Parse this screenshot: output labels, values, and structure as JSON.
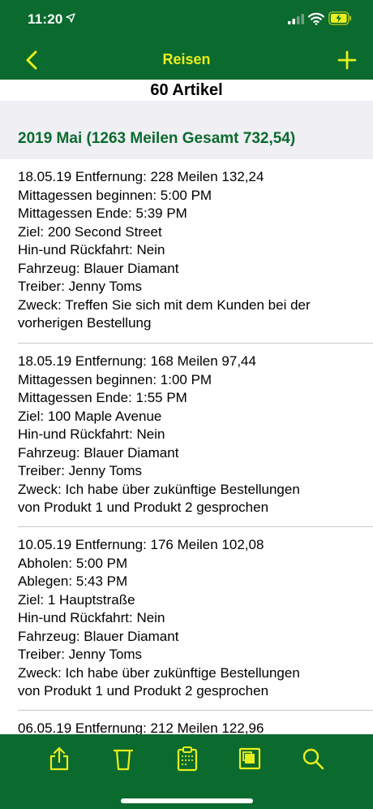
{
  "status_bar": {
    "time": "11:20",
    "location_icon": "location-arrow-icon",
    "signal_icon": "cellular-signal-icon",
    "wifi_icon": "wifi-icon",
    "battery_icon": "battery-charging-icon"
  },
  "nav": {
    "title": "Reisen",
    "back_icon": "chevron-left-icon",
    "add_icon": "plus-icon"
  },
  "colors": {
    "brand_green": "#0b6a2e",
    "accent_yellow": "#e8ef1c",
    "section_bg": "#efeff4"
  },
  "count_label": "60 Artikel",
  "section": {
    "title": "2019 Mai (1263 Meilen Gesamt 732,54)"
  },
  "entries": [
    {
      "lines": [
        "18.05.19 Entfernung: 228 Meilen 132,24",
        "Mittagessen beginnen: 5:00 PM",
        "Mittagessen Ende: 5:39 PM",
        "Ziel: 200 Second Street",
        "Hin-und Rückfahrt: Nein",
        "Fahrzeug: Blauer Diamant",
        "Treiber: Jenny Toms",
        "Zweck: Treffen Sie sich mit dem Kunden bei der",
        "vorherigen Bestellung"
      ]
    },
    {
      "lines": [
        "18.05.19 Entfernung: 168 Meilen 97,44",
        "Mittagessen beginnen: 1:00 PM",
        "Mittagessen Ende: 1:55 PM",
        "Ziel: 100 Maple Avenue",
        "Hin-und Rückfahrt: Nein",
        "Fahrzeug: Blauer Diamant",
        "Treiber: Jenny Toms",
        "Zweck: Ich habe über zukünftige Bestellungen",
        "von Produkt 1 und Produkt 2 gesprochen"
      ]
    },
    {
      "lines": [
        "10.05.19 Entfernung: 176 Meilen 102,08",
        "Abholen: 5:00 PM",
        "Ablegen: 5:43 PM",
        "Ziel: 1 Hauptstraße",
        "Hin-und Rückfahrt: Nein",
        "Fahrzeug: Blauer Diamant",
        "Treiber: Jenny Toms",
        "Zweck: Ich habe über zukünftige Bestellungen",
        "von Produkt 1 und Produkt 2 gesprochen"
      ]
    },
    {
      "lines": [
        "06.05.19 Entfernung: 212 Meilen 122,96"
      ]
    }
  ],
  "toolbar": {
    "icons": [
      "share-icon",
      "trash-icon",
      "clipboard-report-icon",
      "copy-square-icon",
      "search-icon"
    ]
  }
}
